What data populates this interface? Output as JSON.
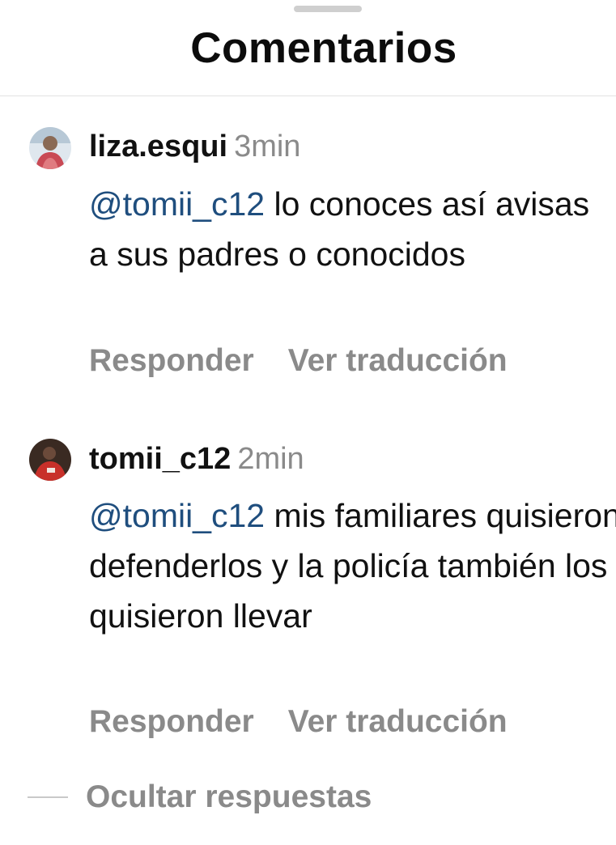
{
  "sheet": {
    "title": "Comentarios"
  },
  "comments": [
    {
      "username": "liza.esqui",
      "time": "3min",
      "mention": "@tomii_c12",
      "text": " lo conoces así avisas a sus padres o conocidos",
      "reply_label": "Responder",
      "translate_label": "Ver traducción",
      "avatar_icon": "profile-photo-icon"
    },
    {
      "username": "tomii_c12",
      "time": "2min",
      "mention": "@tomii_c12",
      "text": " mis familiares quisieron defenderlos y la policía también los quisieron llevar",
      "reply_label": "Responder",
      "translate_label": "Ver traducción",
      "avatar_icon": "profile-photo-icon"
    }
  ],
  "replies": {
    "hide_label": "Ocultar respuestas"
  },
  "colors": {
    "mention": "#1f4e7e",
    "secondary_text": "#8a8a8a",
    "primary_text": "#111111",
    "background": "#ffffff"
  }
}
